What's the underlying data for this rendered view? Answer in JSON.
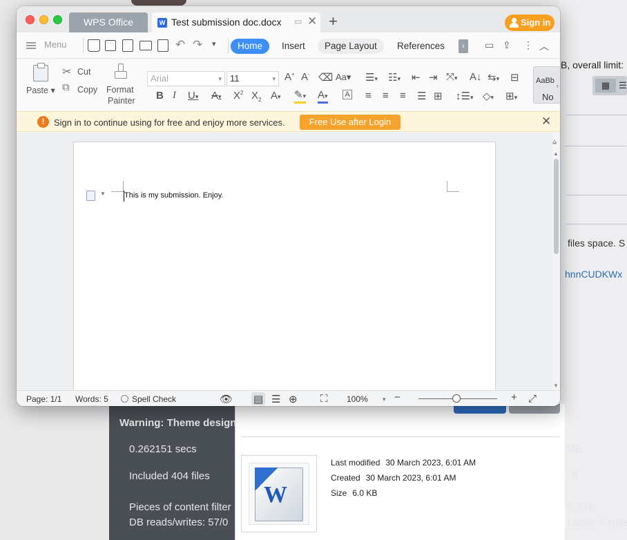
{
  "background": {
    "limit_text": "B, overall limit:",
    "files_text": "files space. S",
    "link_text": "hnnCUDKWx",
    "dark_panel": {
      "warning": "Warning: Theme design",
      "time": "0.262151 secs",
      "included": "Included 404 files",
      "filter": "Pieces of content filter",
      "db": "DB reads/writes: 57/0",
      "mb": "MB",
      "six": ": 6",
      "sys516": "s: 516",
      "sys5": "12sys: 5 cuse"
    },
    "file_info": {
      "last_modified_label": "Last modified",
      "last_modified_value": "30 March 2023, 6:01 AM",
      "created_label": "Created",
      "created_value": "30 March 2023, 6:01 AM",
      "size_label": "Size",
      "size_value": "6.0 KB",
      "icon_letter": "W"
    }
  },
  "window": {
    "tabs": {
      "home_tab": "WPS Office",
      "doc_tab": "Test submission doc.docx",
      "doc_icon_letter": "W"
    },
    "signin_label": "Sign in",
    "menu_label": "Menu",
    "ribbon_tabs": [
      "Home",
      "Insert",
      "Page Layout",
      "References"
    ],
    "toolbar": {
      "paste": "Paste",
      "cut": "Cut",
      "copy": "Copy",
      "format_painter_1": "Format",
      "format_painter_2": "Painter",
      "font_name": "Arial",
      "font_size": "11",
      "style_preview": "AaBb",
      "style_name": "No"
    },
    "banner": {
      "message": "Sign in to continue using for free and enjoy more services.",
      "button": "Free Use after Login"
    },
    "document": {
      "text": "This is my submission. Enjoy."
    },
    "status": {
      "page": "Page: 1/1",
      "words": "Words: 5",
      "spell": "Spell Check",
      "zoom": "100%"
    }
  },
  "colors": {
    "accent": "#3d8ef7",
    "signin": "#f9a020",
    "banner_button": "#f6a32b"
  }
}
